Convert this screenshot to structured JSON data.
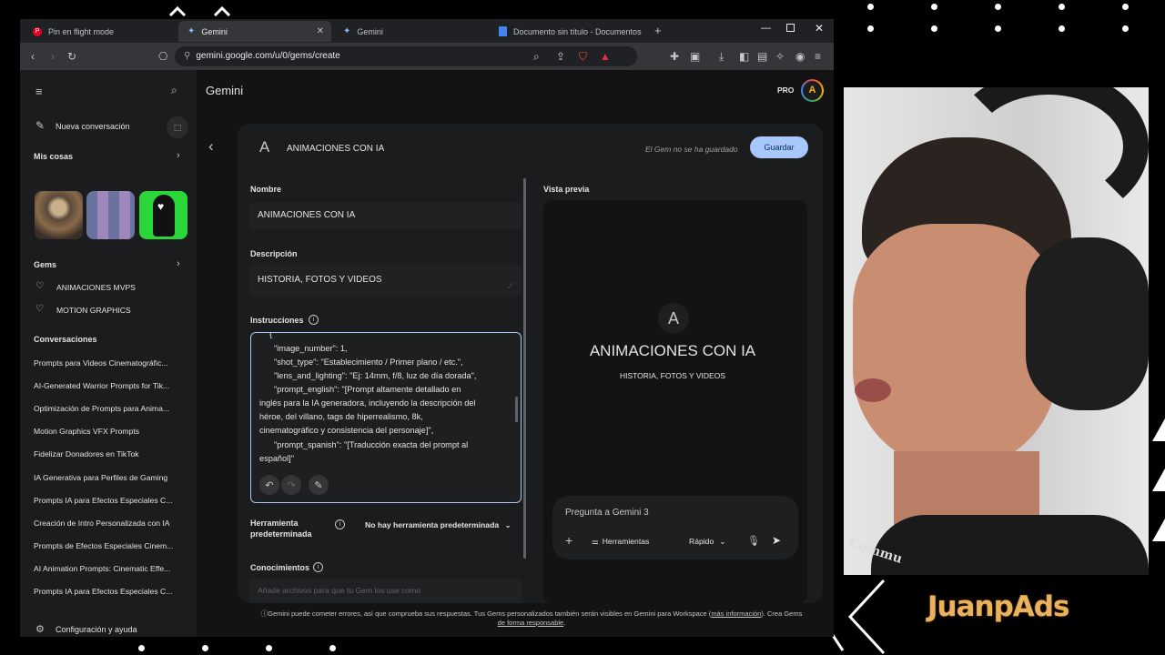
{
  "tabs": [
    {
      "label": "Pin en flight mode",
      "icon": "pinterest-icon"
    },
    {
      "label": "Gemini",
      "icon": "gemini-icon",
      "close": "✕"
    },
    {
      "label": "Gemini",
      "icon": "gemini-icon"
    },
    {
      "label": "Documento sin título - Documentos",
      "icon": "docs-icon"
    }
  ],
  "address": {
    "url": "gemini.google.com/u/0/gems/create"
  },
  "header": {
    "app_title": "Gemini",
    "pro_badge": "PRO",
    "avatar_letter": "A"
  },
  "sidebar": {
    "new_chat": "Nueva conversación",
    "my_stuff": "Mis cosas",
    "gems_heading": "Gems",
    "gems": [
      "ANIMACIONES MVPS",
      "MOTION GRAPHICS"
    ],
    "conversations_heading": "Conversaciones",
    "conversations": [
      "Prompts para Videos Cinematográfic...",
      "AI-Generated Warrior Prompts for Tik...",
      "Optimización de Prompts para Anima...",
      "Motion Graphics VFX Prompts",
      "Fidelizar Donadores en TikTok",
      "IA Generativa para Perfiles de Gaming",
      "Prompts IA para Efectos Especiales C...",
      "Creación de Intro Personalizada con IA",
      "Prompts de Efectos Especiales Cinem...",
      "AI Animation Prompts: Cinematic Effe...",
      "Prompts IA para Efectos Especiales C..."
    ],
    "settings": "Configuración y ayuda"
  },
  "gem": {
    "letter": "A",
    "name_title": "ANIMACIONES CON IA",
    "not_saved": "El Gem no se ha guardado",
    "save": "Guardar",
    "name_label": "Nombre",
    "name_value": "ANIMACIONES CON IA",
    "desc_label": "Descripción",
    "desc_value": "HISTORIA, FOTOS Y VIDEOS",
    "instr_label": "Instrucciones",
    "instructions": [
      "{",
      "\"image_number\": 1,",
      "\"shot_type\": \"Establecimiento / Primer plano / etc.\",",
      "\"lens_and_lighting\": \"Ej: 14mm, f/8, luz de día dorada\",",
      "\"prompt_english\": \"[Prompt altamente detallado en",
      "inglés para la IA generadora, incluyendo la descripción del",
      "héroe, del villano, tags de hiperrealismo, 8k,",
      "cinematográfico y consistencia del personaje]\",",
      "\"prompt_spanish\": \"[Traducción exacta del prompt al",
      "español]\""
    ],
    "tool_label": "Herramienta predeterminada",
    "tool_value": "No hay herramienta predeterminada",
    "knowledge_label": "Conocimientos",
    "knowledge_hint": "Añade archivos para que tu Gem los use como"
  },
  "preview": {
    "label": "Vista previa",
    "letter": "A",
    "title": "ANIMACIONES CON IA",
    "subtitle": "HISTORIA, FOTOS Y VIDEOS",
    "ask_placeholder": "Pregunta a Gemini 3",
    "tools": "Herramientas",
    "mode": "Rápido"
  },
  "footer": {
    "disclaimer": "Gemini puede cometer errores, así que comprueba sus respuestas. Tus Gems personalizados también serán visibles en Gemini para Workspace (",
    "link1": "más información",
    "after_link": "). Crea Gems",
    "link2": "de forma responsable",
    "end": "."
  },
  "overlay": {
    "brand": "JuanpAds",
    "cap_text": "Commu"
  },
  "colors": {
    "accent_blue": "#a8c7fa",
    "save_button": "#a8c7fa",
    "panel": "#1b1c1d",
    "bg": "#131314"
  }
}
